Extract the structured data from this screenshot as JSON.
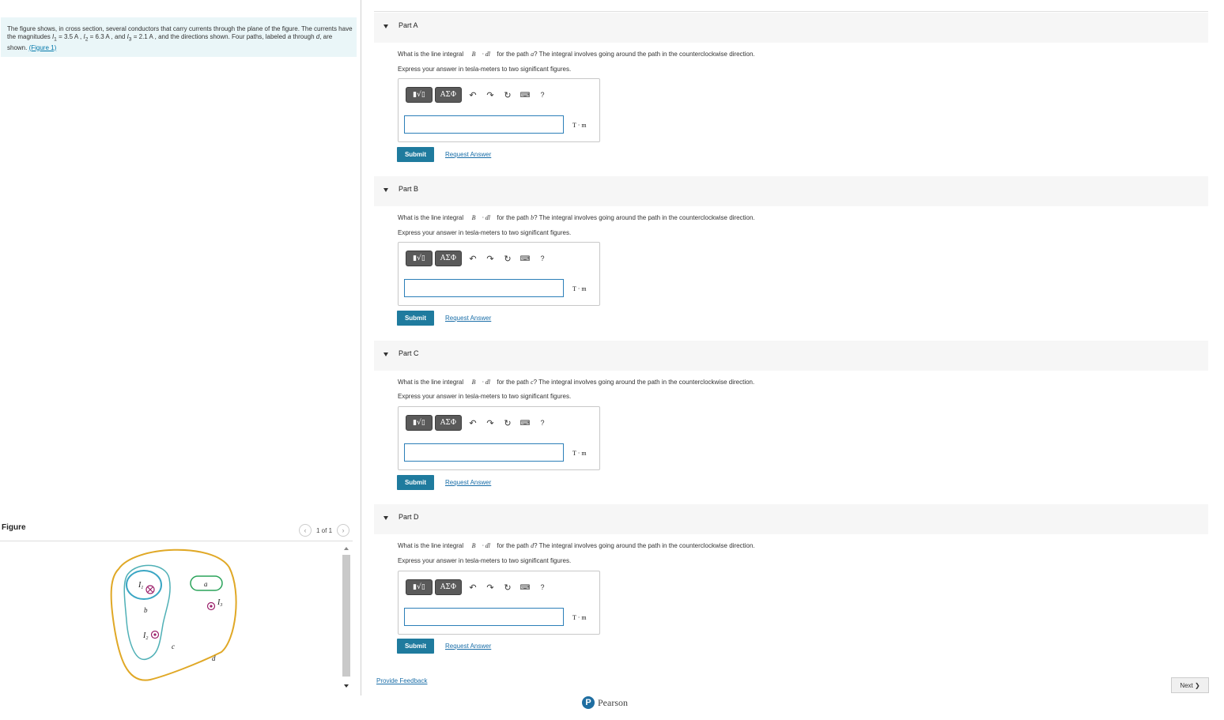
{
  "problem": {
    "text_1": "The figure shows, in cross section, several conductors that carry currents through the plane of the figure. The currents have the magnitudes",
    "i1_label": "I",
    "i1_sub": "1",
    "i1_value": " = 3.5 A , ",
    "i2_label": "I",
    "i2_sub": "2",
    "i2_value": " = 6.3 A , and ",
    "i3_label": "I",
    "i3_sub": "3",
    "i3_value": " = 2.1 A , and the directions shown. Four paths, labeled ",
    "paths_label": "a",
    "paths_mid": " through ",
    "paths_label2": "d",
    "paths_end": ", are shown. ",
    "figure_link": "(Figure 1)"
  },
  "figure_panel": {
    "title": "Figure",
    "pager": "1 of 1",
    "labels": {
      "i1": "I",
      "i1_sub": "1",
      "i2": "I",
      "i2_sub": "2",
      "i3": "I",
      "i3_sub": "3",
      "a": "a",
      "b": "b",
      "c": "c",
      "d": "d"
    }
  },
  "parts": [
    {
      "label": "Part A",
      "question_pre": "What is the line integral ",
      "integral": "∮ B⃗ · dl⃗",
      "question_mid": " for the path ",
      "path": "a",
      "question_post": "? The integral involves going around the path in the counterclockwise direction.",
      "instruction": "Express your answer in tesla-meters to two significant figures.",
      "unit": "T · m",
      "submit": "Submit",
      "request": "Request Answer",
      "value": ""
    },
    {
      "label": "Part B",
      "question_pre": "What is the line integral ",
      "integral": "∮ B⃗ · dl⃗",
      "question_mid": " for the path ",
      "path": "b",
      "question_post": "? The integral involves going around the path in the counterclockwise direction.",
      "instruction": "Express your answer in tesla-meters to two significant figures.",
      "unit": "T · m",
      "submit": "Submit",
      "request": "Request Answer",
      "value": ""
    },
    {
      "label": "Part C",
      "question_pre": "What is the line integral ",
      "integral": "∮ B⃗ · dl⃗",
      "question_mid": " for the path ",
      "path": "c",
      "question_post": "? The integral involves going around the path in the counterclockwise direction.",
      "instruction": "Express your answer in tesla-meters to two significant figures.",
      "unit": "T · m",
      "submit": "Submit",
      "request": "Request Answer",
      "value": ""
    },
    {
      "label": "Part D",
      "question_pre": "What is the line integral ",
      "integral": "∮ B⃗ · dl⃗",
      "question_mid": " for the path ",
      "path": "d",
      "question_post": "? The integral involves going around the path in the counterclockwise direction.",
      "instruction": "Express your answer in tesla-meters to two significant figures.",
      "unit": "T · m",
      "submit": "Submit",
      "request": "Request Answer",
      "value": ""
    }
  ],
  "toolbar": {
    "template_btn": "▮√▯",
    "greek_btn": "ΑΣΦ",
    "undo": "↶",
    "redo": "↷",
    "reset": "↻",
    "keyboard": "⌨",
    "help": "?"
  },
  "footer": {
    "feedback": "Provide Feedback",
    "next": "Next ❯",
    "brand": "Pearson",
    "brand_logo": "P"
  },
  "colors": {
    "path_a": "#2aa35a",
    "path_b": "#3aa6c4",
    "path_c": "#4fb0b6",
    "path_d": "#e0a826",
    "current": "#9b1f6a",
    "submit": "#1f7b9e"
  }
}
